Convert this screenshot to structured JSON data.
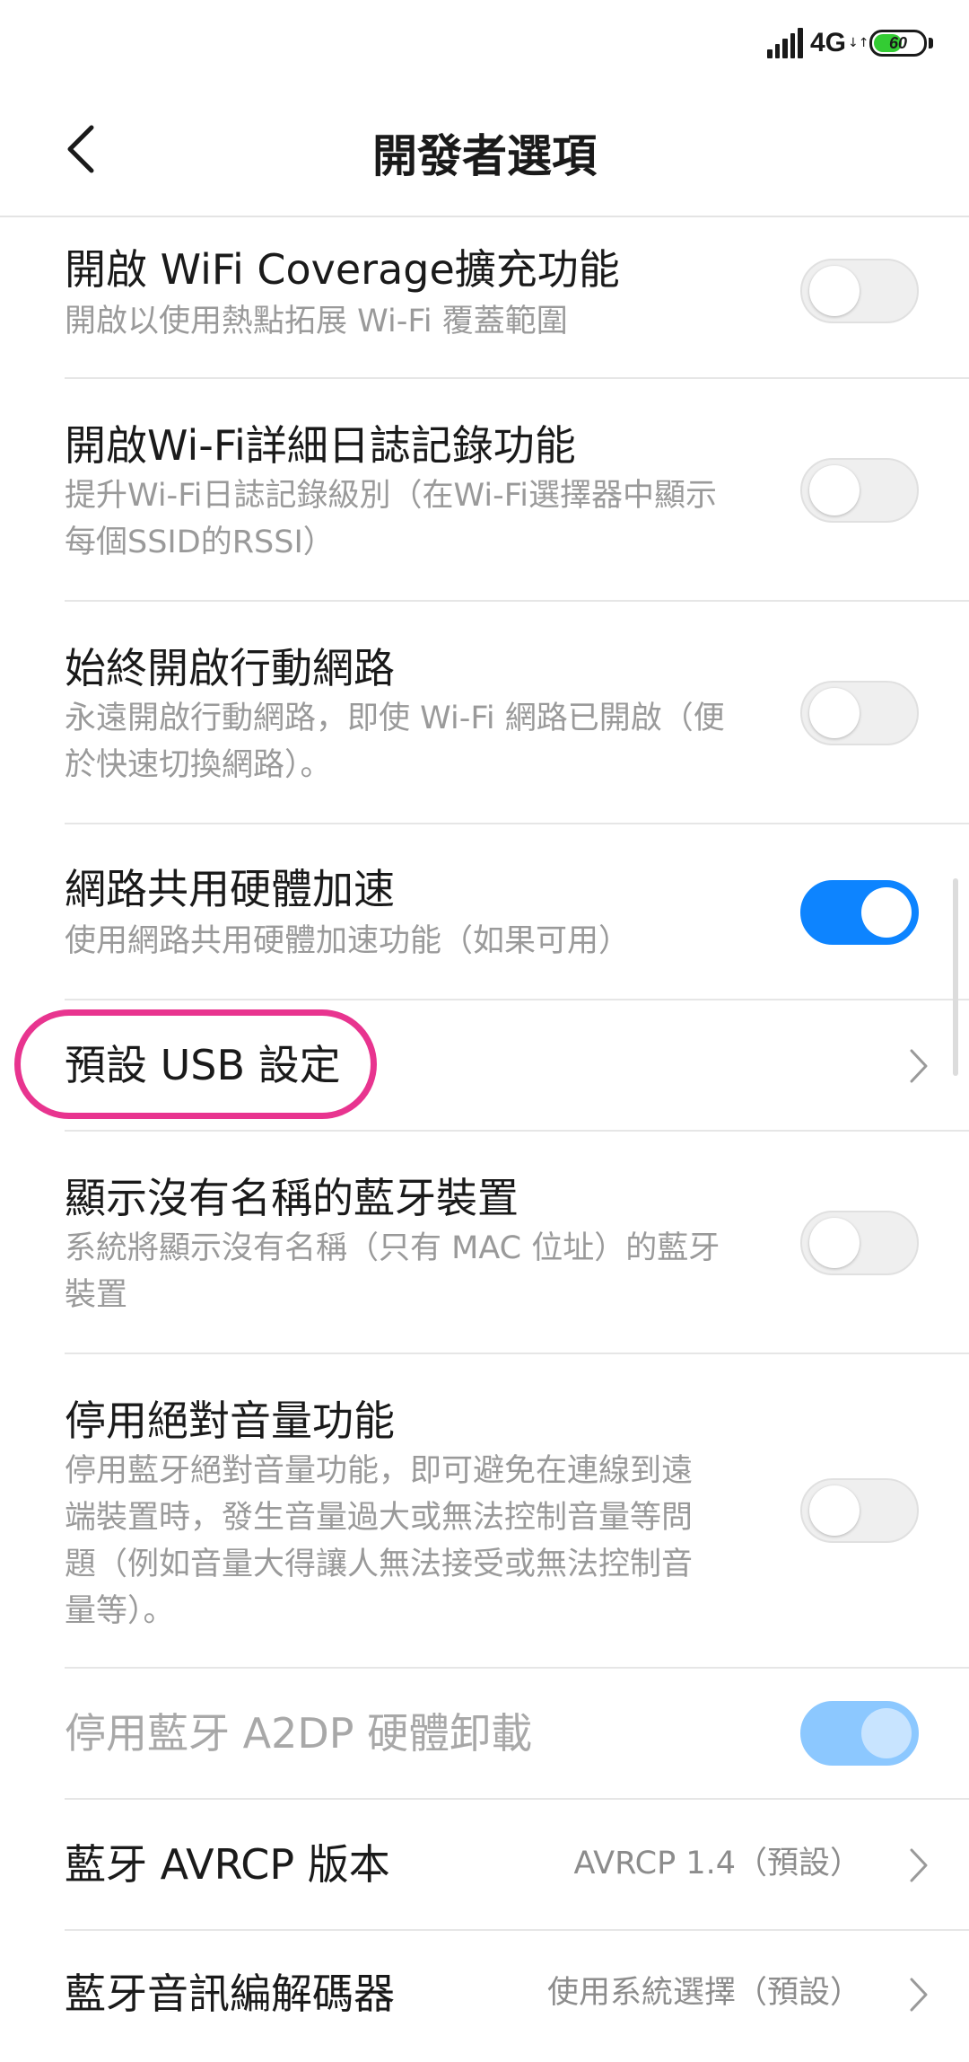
{
  "status_bar": {
    "network": "4G",
    "data_arrows": "↓↑",
    "battery_level": "60",
    "battery_fraction": 0.6
  },
  "header": {
    "title": "開發者選項",
    "back_icon": "chevron-left-icon"
  },
  "colors": {
    "accent": "#0d84ff",
    "highlight": "#e8348f"
  },
  "settings": [
    {
      "title": "開啟 WiFi Coverage擴充功能",
      "subtitle_lines": [
        "開啟以使用熱點拓展 Wi-Fi 覆蓋範圍"
      ],
      "control": "toggle",
      "state": "off"
    },
    {
      "title": "開啟Wi-Fi詳細日誌記錄功能",
      "subtitle_lines": [
        "提升Wi-Fi日誌記錄級別（在Wi-Fi選擇器中顯示",
        "每個SSID的RSSI）"
      ],
      "control": "toggle",
      "state": "off"
    },
    {
      "title": "始終開啟行動網路",
      "subtitle_lines": [
        "永遠開啟行動網路，即使 Wi-Fi 網路已開啟（便",
        "於快速切換網路）。"
      ],
      "control": "toggle",
      "state": "off"
    },
    {
      "title": "網路共用硬體加速",
      "subtitle_lines": [
        "使用網路共用硬體加速功能（如果可用）"
      ],
      "control": "toggle",
      "state": "on"
    },
    {
      "title": "預設 USB 設定",
      "control": "chevron"
    },
    {
      "title": "顯示沒有名稱的藍牙裝置",
      "subtitle_lines": [
        "系統將顯示沒有名稱（只有 MAC 位址）的藍牙",
        "裝置"
      ],
      "control": "toggle",
      "state": "off"
    },
    {
      "title": "停用絕對音量功能",
      "subtitle_lines": [
        "停用藍牙絕對音量功能，即可避免在連線到遠",
        "端裝置時，發生音量過大或無法控制音量等問",
        "題（例如音量大得讓人無法接受或無法控制音",
        "量等）。"
      ],
      "control": "toggle",
      "state": "off"
    },
    {
      "title": "停用藍牙 A2DP 硬體卸載",
      "control": "toggle",
      "state": "on-disabled"
    },
    {
      "title": "藍牙 AVRCP 版本",
      "value": "AVRCP 1.4（預設）",
      "control": "chevron"
    },
    {
      "title": "藍牙音訊編解碼器",
      "value": "使用系統選擇（預設）",
      "control": "chevron"
    }
  ]
}
